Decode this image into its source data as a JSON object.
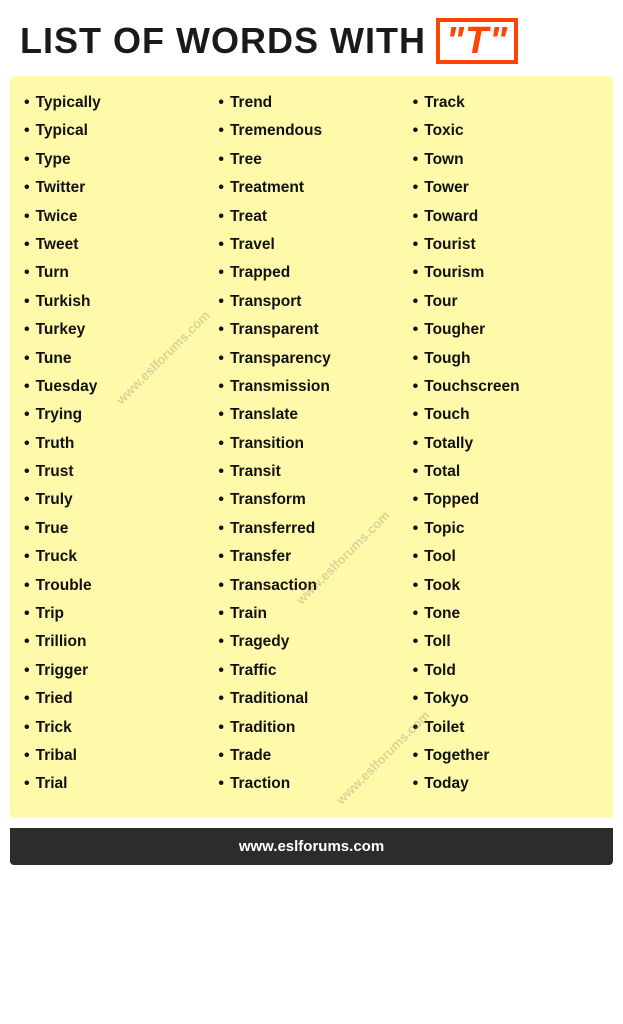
{
  "header": {
    "title": "LIST OF WORDS WITH",
    "badge": "\"T\""
  },
  "columns": [
    {
      "words": [
        "Typically",
        "Typical",
        "Type",
        "Twitter",
        "Twice",
        "Tweet",
        "Turn",
        "Turkish",
        "Turkey",
        "Tune",
        "Tuesday",
        "Trying",
        "Truth",
        "Trust",
        "Truly",
        "True",
        "Truck",
        "Trouble",
        "Trip",
        "Trillion",
        "Trigger",
        "Tried",
        "Trick",
        "Tribal",
        "Trial"
      ]
    },
    {
      "words": [
        "Trend",
        "Tremendous",
        "Tree",
        "Treatment",
        "Treat",
        "Travel",
        "Trapped",
        "Transport",
        "Transparent",
        "Transparency",
        "Transmission",
        "Translate",
        "Transition",
        "Transit",
        "Transform",
        "Transferred",
        "Transfer",
        "Transaction",
        "Train",
        "Tragedy",
        "Traffic",
        "Traditional",
        "Tradition",
        "Trade",
        "Traction"
      ]
    },
    {
      "words": [
        "Track",
        "Toxic",
        "Town",
        "Tower",
        "Toward",
        "Tourist",
        "Tourism",
        "Tour",
        "Tougher",
        "Tough",
        "Touchscreen",
        "Touch",
        "Totally",
        "Total",
        "Topped",
        "Topic",
        "Tool",
        "Took",
        "Tone",
        "Toll",
        "Told",
        "Tokyo",
        "Toilet",
        "Together",
        "Today"
      ]
    }
  ],
  "footer": "www.eslforums.com",
  "watermarks": [
    "www.eslforums.com",
    "www.eslforums.com",
    "www.eslforums.com"
  ]
}
